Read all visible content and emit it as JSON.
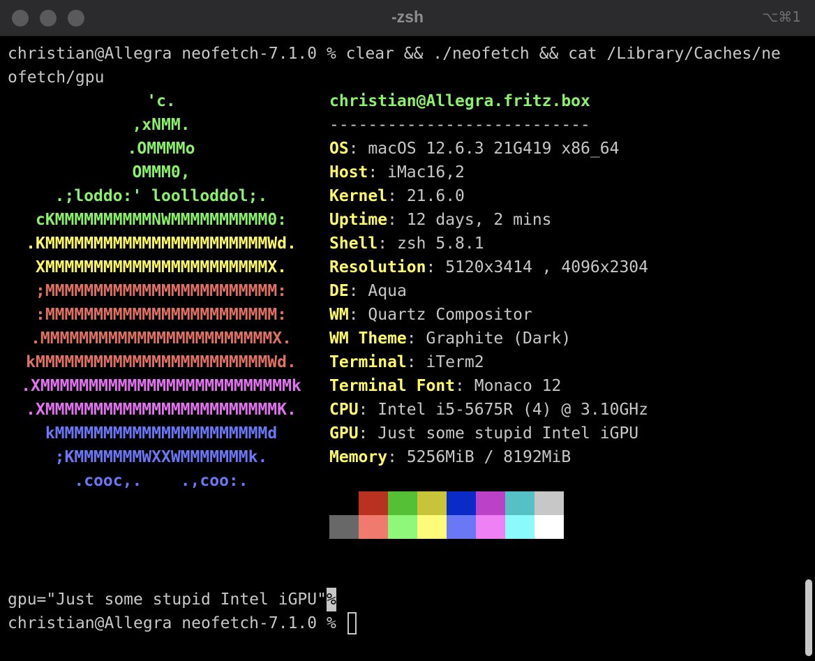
{
  "window": {
    "title": "-zsh",
    "shortcut": "⌥⌘1"
  },
  "terminal": {
    "command_line_1": "christian@Allegra neofetch-7.1.0 % clear && ./neofetch && cat /Library/Caches/ne",
    "command_line_2": "ofetch/gpu",
    "art": [
      {
        "text": "'c.",
        "color": "#8bf16c"
      },
      {
        "text": ",xNMM.",
        "color": "#8bf16c"
      },
      {
        "text": ".OMMMMo",
        "color": "#8bf16c"
      },
      {
        "text": "OMMM0,",
        "color": "#8bf16c"
      },
      {
        "text": ".;loddo:' loolloddol;.",
        "color": "#8bf16c"
      },
      {
        "text": "cKMMMMMMMMMMNWMMMMMMMMMM0:",
        "color": "#8bf16c"
      },
      {
        "text": ".KMMMMMMMMMMMMMMMMMMMMMMMWd.",
        "color": "#fffb66"
      },
      {
        "text": "XMMMMMMMMMMMMMMMMMMMMMMMX.",
        "color": "#fffb66"
      },
      {
        "text": ";MMMMMMMMMMMMMMMMMMMMMMMM:",
        "color": "#e07263"
      },
      {
        "text": ":MMMMMMMMMMMMMMMMMMMMMMMM:",
        "color": "#e07263"
      },
      {
        "text": ".MMMMMMMMMMMMMMMMMMMMMMMMX.",
        "color": "#e07263"
      },
      {
        "text": "kMMMMMMMMMMMMMMMMMMMMMMMMWd.",
        "color": "#e07263"
      },
      {
        "text": ".XMMMMMMMMMMMMMMMMMMMMMMMMMMk",
        "color": "#e274f0"
      },
      {
        "text": ".XMMMMMMMMMMMMMMMMMMMMMMMMK.",
        "color": "#e274f0"
      },
      {
        "text": "kMMMMMMMMMMMMMMMMMMMMMMd",
        "color": "#6b78f5"
      },
      {
        "text": ";KMMMMMMMWXXWMMMMMMMk.",
        "color": "#6b78f5"
      },
      {
        "text": ".cooc,.    .,coo:.",
        "color": "#6b78f5"
      }
    ],
    "header": "christian@Allegra.fritz.box",
    "divider": "---------------------------",
    "info": [
      {
        "key": "OS",
        "value": "macOS 12.6.3 21G419 x86_64"
      },
      {
        "key": "Host",
        "value": "iMac16,2"
      },
      {
        "key": "Kernel",
        "value": "21.6.0"
      },
      {
        "key": "Uptime",
        "value": "12 days, 2 mins"
      },
      {
        "key": "Shell",
        "value": "zsh 5.8.1"
      },
      {
        "key": "Resolution",
        "value": "5120x3414 , 4096x2304"
      },
      {
        "key": "DE",
        "value": "Aqua"
      },
      {
        "key": "WM",
        "value": "Quartz Compositor"
      },
      {
        "key": "WM Theme",
        "value": "Graphite (Dark)"
      },
      {
        "key": "Terminal",
        "value": "iTerm2"
      },
      {
        "key": "Terminal Font",
        "value": "Monaco 12"
      },
      {
        "key": "CPU",
        "value": "Intel i5-5675R (4) @ 3.10GHz"
      },
      {
        "key": "GPU",
        "value": "Just some stupid Intel iGPU"
      },
      {
        "key": "Memory",
        "value": "5256MiB / 8192MiB"
      }
    ],
    "separator": ":",
    "palette_normal": [
      "#000000",
      "#b8321f",
      "#55bf35",
      "#c7c43a",
      "#0a2bc7",
      "#bb41c7",
      "#55c1c7",
      "#c7c7c7"
    ],
    "palette_bright": [
      "#686868",
      "#f07a6d",
      "#8ff87b",
      "#fffb7a",
      "#6b78f5",
      "#ef80f5",
      "#8cfafd",
      "#ffffff"
    ],
    "output_line": "gpu=\"Just some stupid Intel iGPU\"",
    "no_newline_marker": "%",
    "prompt_line": "christian@Allegra neofetch-7.1.0 % "
  }
}
